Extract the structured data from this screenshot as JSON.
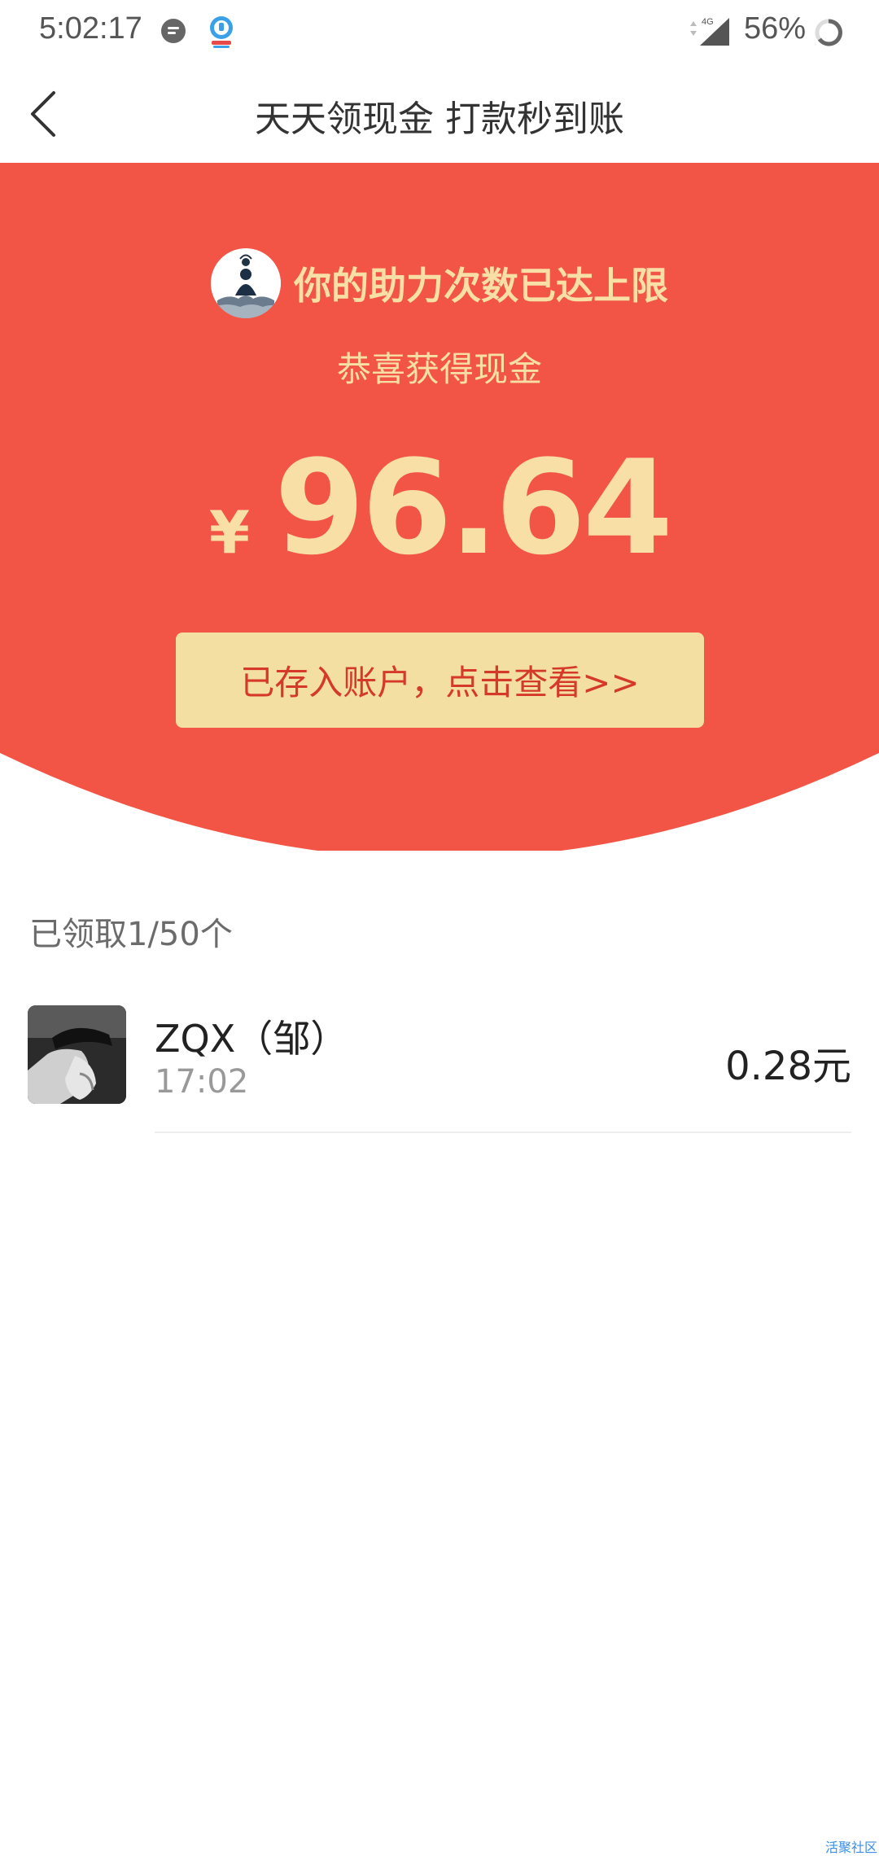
{
  "status_bar": {
    "time": "5:02:17",
    "battery": "56%",
    "network": "4G",
    "icons": [
      "chat-icon",
      "app-notify-icon",
      "signal-icon",
      "battery-icon"
    ]
  },
  "nav": {
    "title": "天天领现金 打款秒到账",
    "back_icon": "chevron-left-icon"
  },
  "hero": {
    "heading": "你的助力次数已达上限",
    "subtitle": "恭喜获得现金",
    "currency": "¥",
    "amount": "96.64",
    "button_label": "已存入账户，点击查看>>"
  },
  "received": {
    "count_label": "已领取1/50个",
    "items": [
      {
        "name": "ZQX（邹）",
        "time": "17:02",
        "amount": "0.28元"
      }
    ]
  },
  "watermark": "活聚社区",
  "colors": {
    "hero_red": "#f25546",
    "gold_text": "#f7dfa6",
    "button_bg": "#f4dfa3",
    "button_text": "#d4392a"
  }
}
